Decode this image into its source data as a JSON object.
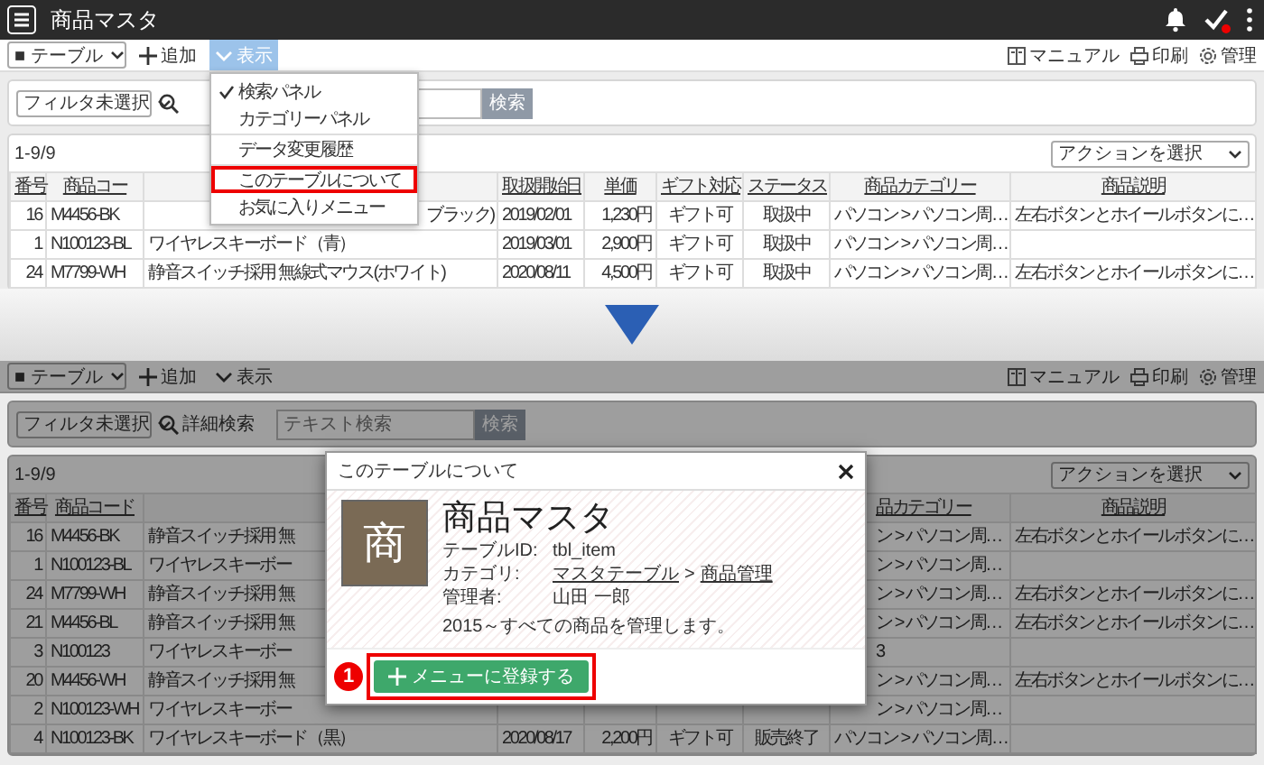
{
  "top_screen": {
    "app_bar": {
      "title": "商品マスタ"
    },
    "toolbar": {
      "table_select": "■ テーブル",
      "add": "追加",
      "view": {
        "label": "表示",
        "selected": true
      },
      "links": [
        {
          "kind": "manual",
          "label": "マニュアル"
        },
        {
          "kind": "print",
          "label": "印刷"
        },
        {
          "kind": "settings",
          "label": "管理"
        }
      ]
    },
    "filter": {
      "select": "フィルタ未選択",
      "search_button": "検索"
    },
    "count": "1-9/9",
    "action_select": "アクションを選択",
    "table": {
      "columns": {
        "number": "番号",
        "code": "商品コー",
        "start_date": "取扱開始日",
        "price": "単価",
        "gift": "ギフト対応",
        "status": "ステータス",
        "category": "商品カテゴリー",
        "description": "商品説明"
      },
      "rows": [
        {
          "number": "16",
          "code": "M4456-BK",
          "name": "ブラック)",
          "start_date": "2019/02/01",
          "price": "1,230円",
          "gift": "ギフト可",
          "status": "取扱中",
          "category": "パソコン > パソコン周…",
          "description": "左右ボタンとホイールボタンに…"
        },
        {
          "number": "1",
          "code": "N100123-BL",
          "name": "ワイヤレスキーボード（青）",
          "start_date": "2019/03/01",
          "price": "2,900円",
          "gift": "ギフト可",
          "status": "取扱中",
          "category": "パソコン > パソコン周…"
        },
        {
          "number": "24",
          "code": "M7799-WH",
          "name": "静音スイッチ採用 無線式マウス(ホワイト)",
          "start_date": "2020/08/11",
          "price": "4,500円",
          "gift": "ギフト可",
          "status": "取扱中",
          "category": "パソコン > パソコン周…",
          "description": "左右ボタンとホイールボタンに…"
        }
      ]
    },
    "view_menu": {
      "items": [
        {
          "label": "検索パネル",
          "checked": true,
          "divider_before": false,
          "highlighted": false
        },
        {
          "label": "カテゴリーパネル",
          "checked": false,
          "divider_before": false,
          "highlighted": false
        },
        {
          "label": "データ変更履歴",
          "checked": false,
          "divider_before": true,
          "highlighted": false
        },
        {
          "label": "このテーブルについて",
          "checked": false,
          "divider_before": true,
          "highlighted": true
        },
        {
          "label": "お気に入りメニュー",
          "checked": false,
          "divider_before": false,
          "highlighted": false
        }
      ]
    }
  },
  "bottom_screen": {
    "toolbar": {
      "table_select": "■ テーブル",
      "add": "追加",
      "view": {
        "label": "表示",
        "selected": false
      },
      "links": [
        {
          "kind": "manual",
          "label": "マニュアル"
        },
        {
          "kind": "print",
          "label": "印刷"
        },
        {
          "kind": "settings",
          "label": "管理"
        }
      ]
    },
    "filter": {
      "select": "フィルタ未選択",
      "detail_search": "詳細検索",
      "placeholder": "テキスト検索",
      "search_button": "検索"
    },
    "count": "1-9/9",
    "action_select": "アクションを選択",
    "table": {
      "columns": {
        "number": "番号",
        "code": "商品コード",
        "category": "品カテゴリー",
        "description": "商品説明"
      },
      "rows": [
        {
          "number": "16",
          "code": "M4456-BK",
          "name": "静音スイッチ採用 無",
          "category": "ン > パソコン周…",
          "description": "左右ボタンとホイールボタンに…"
        },
        {
          "number": "1",
          "code": "N100123-BL",
          "name": "ワイヤレスキーボー",
          "category": "ン > パソコン周…"
        },
        {
          "number": "24",
          "code": "M7799-WH",
          "name": "静音スイッチ採用 無",
          "category": "ン > パソコン周…",
          "description": "左右ボタンとホイールボタンに…"
        },
        {
          "number": "21",
          "code": "M4456-BL",
          "name": "静音スイッチ採用 無",
          "category": "ン > パソコン周…",
          "description": "左右ボタンとホイールボタンに…"
        },
        {
          "number": "3",
          "code": "N100123",
          "name": "ワイヤレスキーボー",
          "category": "3"
        },
        {
          "number": "20",
          "code": "M4456-WH",
          "name": "静音スイッチ採用 無",
          "category": "ン > パソコン周…",
          "description": "左右ボタンとホイールボタンに…"
        },
        {
          "number": "2",
          "code": "N100123-WH",
          "name": "ワイヤレスキーボー",
          "category": "ン > パソコン周…"
        },
        {
          "number": "4",
          "code": "N100123-BK",
          "name": "ワイヤレスキーボード（黒）",
          "start_date": "2020/08/17",
          "price": "2,200円",
          "gift": "ギフト可",
          "status": "販売終了",
          "category": "パソコン > パソコン周…"
        }
      ]
    },
    "modal": {
      "title": "このテーブルについて",
      "avatar_char": "商",
      "name": "商品マスタ",
      "fields": [
        {
          "kind": "text",
          "label": "テーブルID:",
          "value": "tbl_item"
        },
        {
          "kind": "breadcrumb",
          "label": "カテゴリ:",
          "links": [
            "マスタテーブル",
            "商品管理"
          ],
          "separator": ">"
        },
        {
          "kind": "text",
          "label": "管理者:",
          "value": "山田 一郎"
        }
      ],
      "description": "2015～すべての商品を管理します。",
      "step": "1",
      "button": {
        "label": "メニューに登録する",
        "highlighted": true
      }
    }
  }
}
